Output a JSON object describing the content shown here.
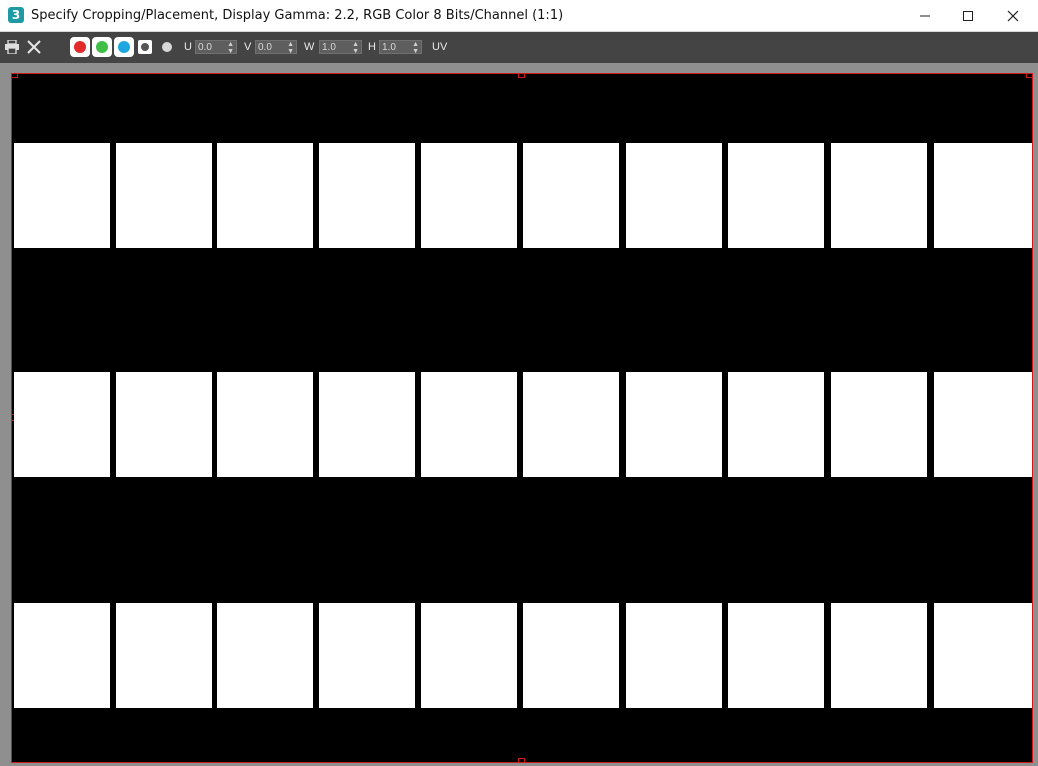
{
  "window": {
    "app_icon": "3",
    "title": "Specify Cropping/Placement, Display Gamma: 2.2, RGB Color 8 Bits/Channel (1:1)",
    "controls": [
      "minimize-icon",
      "maximize-icon",
      "close-icon"
    ]
  },
  "toolbar": {
    "icons": [
      "print-icon",
      "close-x-icon"
    ],
    "channels": [
      {
        "name": "red-channel",
        "color": "#e32a2a"
      },
      {
        "name": "green-channel",
        "color": "#3fbf45"
      },
      {
        "name": "blue-channel",
        "color": "#1ea6e0"
      }
    ],
    "alpha_channel_icon": "alpha-channel-icon",
    "mono_icon": "monochrome-dot-icon",
    "fields": [
      {
        "label": "U",
        "value": "0.0"
      },
      {
        "label": "V",
        "value": "0.0"
      },
      {
        "label": "W",
        "value": "1.0"
      },
      {
        "label": "H",
        "value": "1.0"
      }
    ],
    "uv_label": "UV"
  },
  "canvas": {
    "background": "#000000",
    "tile_color": "#ffffff",
    "crop_border_color": "#d01a1a",
    "tile_rows": 3,
    "tiles_per_row": 10
  }
}
